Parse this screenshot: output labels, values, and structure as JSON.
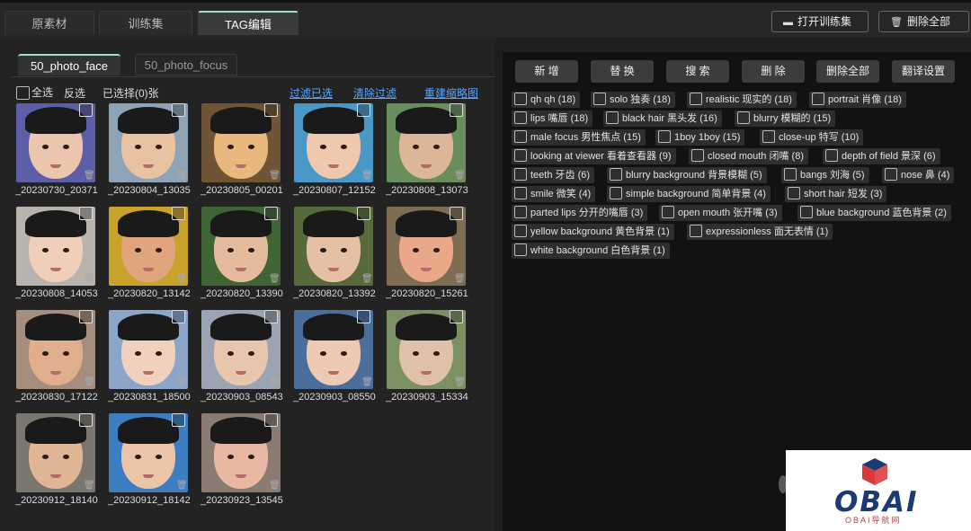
{
  "top_tabs": [
    {
      "label": "原素材"
    },
    {
      "label": "训练集"
    },
    {
      "label": "TAG编辑"
    }
  ],
  "top_buttons": {
    "open_label": "打开训练集",
    "delete_all_label": "删除全部"
  },
  "sub_tabs": [
    {
      "label": "50_photo_face"
    },
    {
      "label": "50_photo_focus"
    }
  ],
  "selection": {
    "select_all": "全选",
    "invert": "反选",
    "selected": "已选择(0)张"
  },
  "links": {
    "filter_selected": "过滤已选",
    "clear_filter": "清除过滤",
    "rebuild_thumbs": "重建缩略图"
  },
  "thumbnails": [
    {
      "name": "_20230730_20371",
      "bg": "#5c5ea8",
      "skin": "#ecc6ac"
    },
    {
      "name": "_20230804_13035",
      "bg": "#8fa3b6",
      "skin": "#e9c2a2"
    },
    {
      "name": "_20230805_00201",
      "bg": "#6f5436",
      "skin": "#e8b87d"
    },
    {
      "name": "_20230807_12152",
      "bg": "#4a98c8",
      "skin": "#efc8ad"
    },
    {
      "name": "_20230808_13073",
      "bg": "#6a8d5e",
      "skin": "#dcb697"
    },
    {
      "name": "_20230808_14053",
      "bg": "#b9b3ad",
      "skin": "#efcfb9"
    },
    {
      "name": "_20230820_13142",
      "bg": "#c9a22c",
      "skin": "#e0a57c"
    },
    {
      "name": "_20230820_13390",
      "bg": "#3f6534",
      "skin": "#e4bb9d"
    },
    {
      "name": "_20230820_13392",
      "bg": "#566a3c",
      "skin": "#e6c0a4"
    },
    {
      "name": "_20230820_15261",
      "bg": "#7e6d52",
      "skin": "#e9a888"
    },
    {
      "name": "_20230830_17122",
      "bg": "#a58e7e",
      "skin": "#dfae8c"
    },
    {
      "name": "_20230831_18500",
      "bg": "#8ba6c9",
      "skin": "#f0d1bd"
    },
    {
      "name": "_20230903_08543",
      "bg": "#9ca4b3",
      "skin": "#e7c6ad"
    },
    {
      "name": "_20230903_08550",
      "bg": "#4c6e9b",
      "skin": "#edcab1"
    },
    {
      "name": "_20230903_15334",
      "bg": "#7c9163",
      "skin": "#dfc0a8"
    },
    {
      "name": "_20230912_18140",
      "bg": "#7b766f",
      "skin": "#e0b594"
    },
    {
      "name": "_20230912_18142",
      "bg": "#3c7ec1",
      "skin": "#ecc5a8"
    },
    {
      "name": "_20230923_13545",
      "bg": "#8a7c73",
      "skin": "#e8b8a2"
    }
  ],
  "actions": [
    {
      "label": "新 增"
    },
    {
      "label": "替 换"
    },
    {
      "label": "搜 索"
    },
    {
      "label": "删 除"
    },
    {
      "label": "删除全部"
    },
    {
      "label": "翻译设置"
    }
  ],
  "tags": [
    {
      "label": "qh qh (18)"
    },
    {
      "label": "solo 独奏 (18)"
    },
    {
      "label": "realistic 现实的 (18)"
    },
    {
      "label": "portrait 肖像 (18)"
    },
    {
      "label": "lips 嘴唇 (18)"
    },
    {
      "label": "black hair 黑头发 (16)"
    },
    {
      "label": "blurry 模糊的 (15)"
    },
    {
      "label": "male focus 男性焦点 (15)"
    },
    {
      "label": "1boy 1boy (15)"
    },
    {
      "label": "close-up 特写 (10)"
    },
    {
      "label": "looking at viewer 看着查看器 (9)"
    },
    {
      "label": "closed mouth 闭嘴 (8)"
    },
    {
      "label": "depth of field 景深 (6)"
    },
    {
      "label": "teeth 牙齿 (6)"
    },
    {
      "label": "blurry background 背景模糊 (5)"
    },
    {
      "label": "bangs 刘海 (5)"
    },
    {
      "label": "nose 鼻 (4)"
    },
    {
      "label": "smile 微笑 (4)"
    },
    {
      "label": "simple background 简单背景 (4)"
    },
    {
      "label": "short hair 短发 (3)"
    },
    {
      "label": "parted lips 分开的嘴唇 (3)"
    },
    {
      "label": "open mouth 张开嘴 (3)"
    },
    {
      "label": "blue background 蓝色背景 (2)"
    },
    {
      "label": "yellow background 黄色背景 (1)"
    },
    {
      "label": "expressionless 面无表情 (1)"
    },
    {
      "label": "white background 白色背景 (1)"
    }
  ],
  "watermark": {
    "logo": "OBAI",
    "sub": "OBAI导航网"
  },
  "colors": {
    "accent": "#9be3c9",
    "link": "#59a6ff"
  }
}
